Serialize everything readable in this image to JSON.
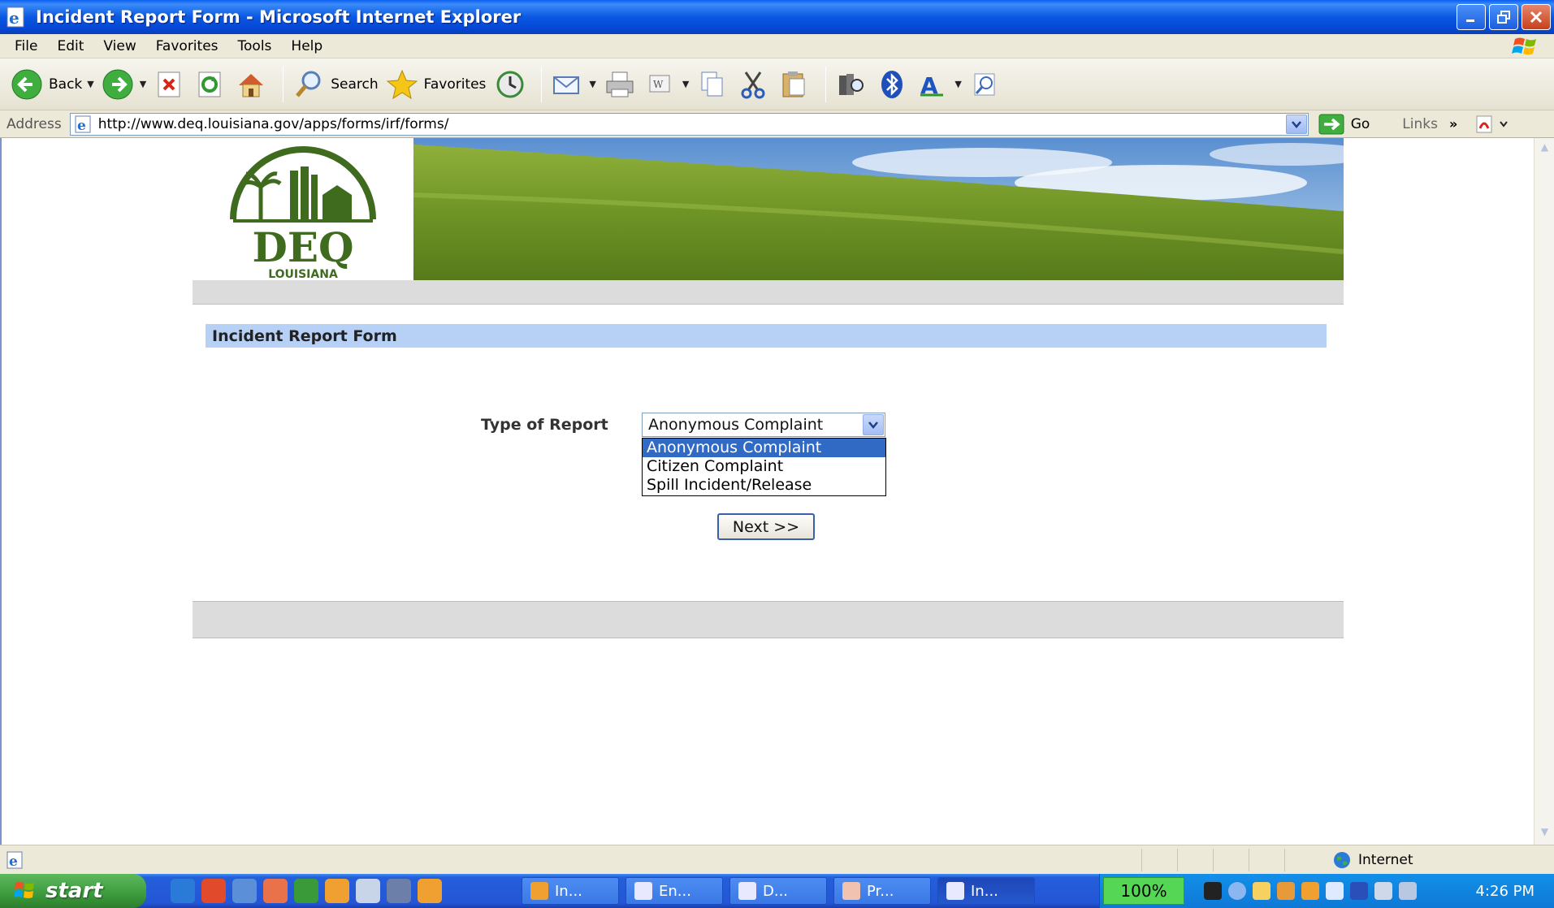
{
  "window": {
    "title": "Incident Report Form - Microsoft Internet Explorer"
  },
  "menu": [
    "File",
    "Edit",
    "View",
    "Favorites",
    "Tools",
    "Help"
  ],
  "toolbar": {
    "back_label": "Back",
    "search_label": "Search",
    "favorites_label": "Favorites"
  },
  "address": {
    "label": "Address",
    "url": "http://www.deq.louisiana.gov/apps/forms/irf/forms/",
    "go_label": "Go",
    "links_label": "Links"
  },
  "page": {
    "logo_text": "DEQ",
    "logo_subtext": "LOUISIANA",
    "form_heading": "Incident Report Form",
    "type_label": "Type of Report",
    "selected_type": "Anonymous Complaint",
    "type_options": [
      "Anonymous Complaint",
      "Citizen Complaint",
      "Spill Incident/Release"
    ],
    "next_label": "Next >>"
  },
  "status": {
    "zone": "Internet"
  },
  "taskbar": {
    "start_label": "start",
    "tasks": [
      "In...",
      "En...",
      "D...",
      "Pr...",
      "In..."
    ],
    "zoom": "100%",
    "clock": "4:26 PM"
  },
  "colors": {
    "title_blue": "#0a58e2",
    "heading_bg": "#b6d0f6",
    "selection": "#316ac5",
    "logo_green": "#3f6b1f"
  }
}
